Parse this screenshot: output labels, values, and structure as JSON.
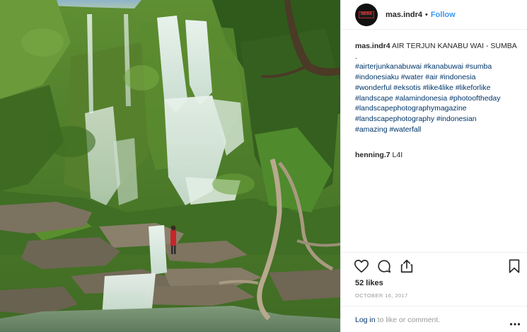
{
  "post": {
    "username": "mas.indr4",
    "separator": "•",
    "follow_label": "Follow",
    "avatar_text": "INDRA",
    "caption": {
      "title": "AIR TERJUN KANABU WAI - SUMBA",
      "dot_line": ".",
      "hashtag_lines": [
        "#airterjunkanabuwai #kanabuwai #sumba",
        "#indonesiaku #water #air #indonesia",
        "#wonderful #eksotis #like4like #likeforlike",
        "#landscape #alamindonesia #photooftheday",
        "#landscapephotographymagazine",
        "#landscapephotography #indonesian",
        "#amazing #waterfall"
      ]
    },
    "comments": [
      {
        "user": "henning.7",
        "text": "L4I"
      }
    ],
    "likes": "52 likes",
    "date": "OCTOBER 16, 2017",
    "login": {
      "link": "Log in",
      "suffix": "to like or comment."
    }
  },
  "icons": {
    "like": "heart-icon",
    "comment": "comment-icon",
    "share": "share-icon",
    "save": "bookmark-icon",
    "more": "more-dots-icon"
  },
  "colors": {
    "link_blue": "#3897f0",
    "hashtag": "#003569",
    "muted": "#999999",
    "text": "#262626"
  }
}
